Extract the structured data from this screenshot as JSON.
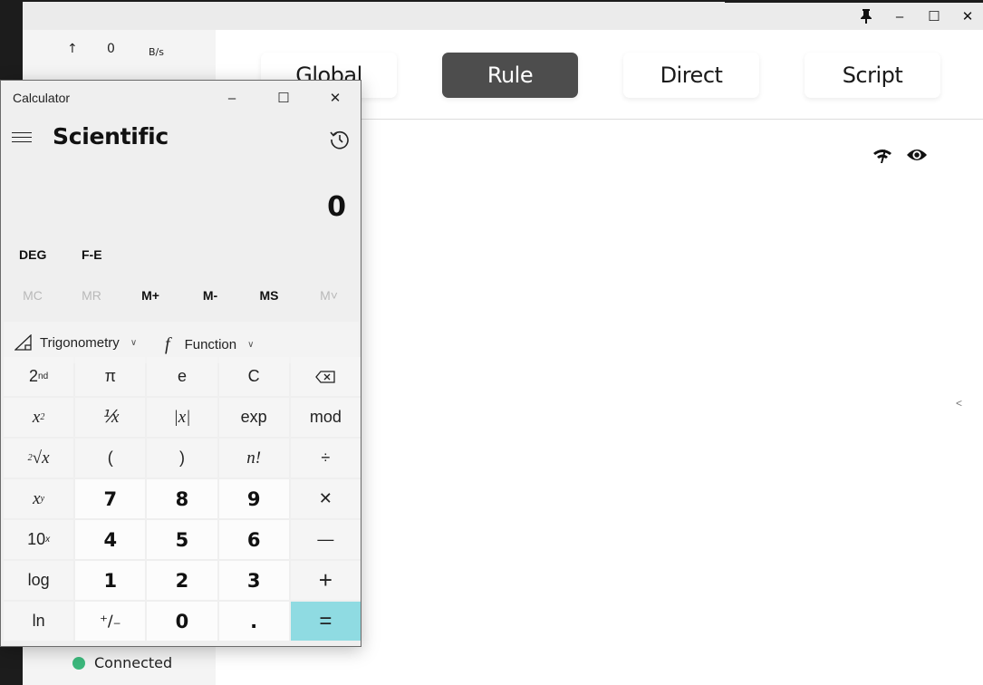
{
  "background_app": {
    "window_controls": {
      "pin": "pin-icon",
      "minimize": "–",
      "maximize": "☐",
      "close": "✕"
    },
    "sidebar": {
      "upload_arrow": "↑",
      "upload_speed": "0",
      "upload_unit": "B/s",
      "status_text": "Connected",
      "status_color": "#3cb87c"
    },
    "modes": [
      {
        "label": "Global",
        "active": false
      },
      {
        "label": "Rule",
        "active": true
      },
      {
        "label": "Direct",
        "active": false
      },
      {
        "label": "Script",
        "active": false
      }
    ],
    "collapse_glyph": "<"
  },
  "calculator": {
    "title": "Calculator",
    "mode": "Scientific",
    "display": "0",
    "angle_unit": "DEG",
    "fe": "F-E",
    "memory": [
      {
        "label": "MC",
        "enabled": false
      },
      {
        "label": "MR",
        "enabled": false
      },
      {
        "label": "M+",
        "enabled": true
      },
      {
        "label": "M-",
        "enabled": true
      },
      {
        "label": "MS",
        "enabled": true
      },
      {
        "label": "M˅",
        "enabled": false
      }
    ],
    "trig_label": "Trigonometry",
    "func_label": "Function",
    "equals_color": "#8fdbe2"
  }
}
